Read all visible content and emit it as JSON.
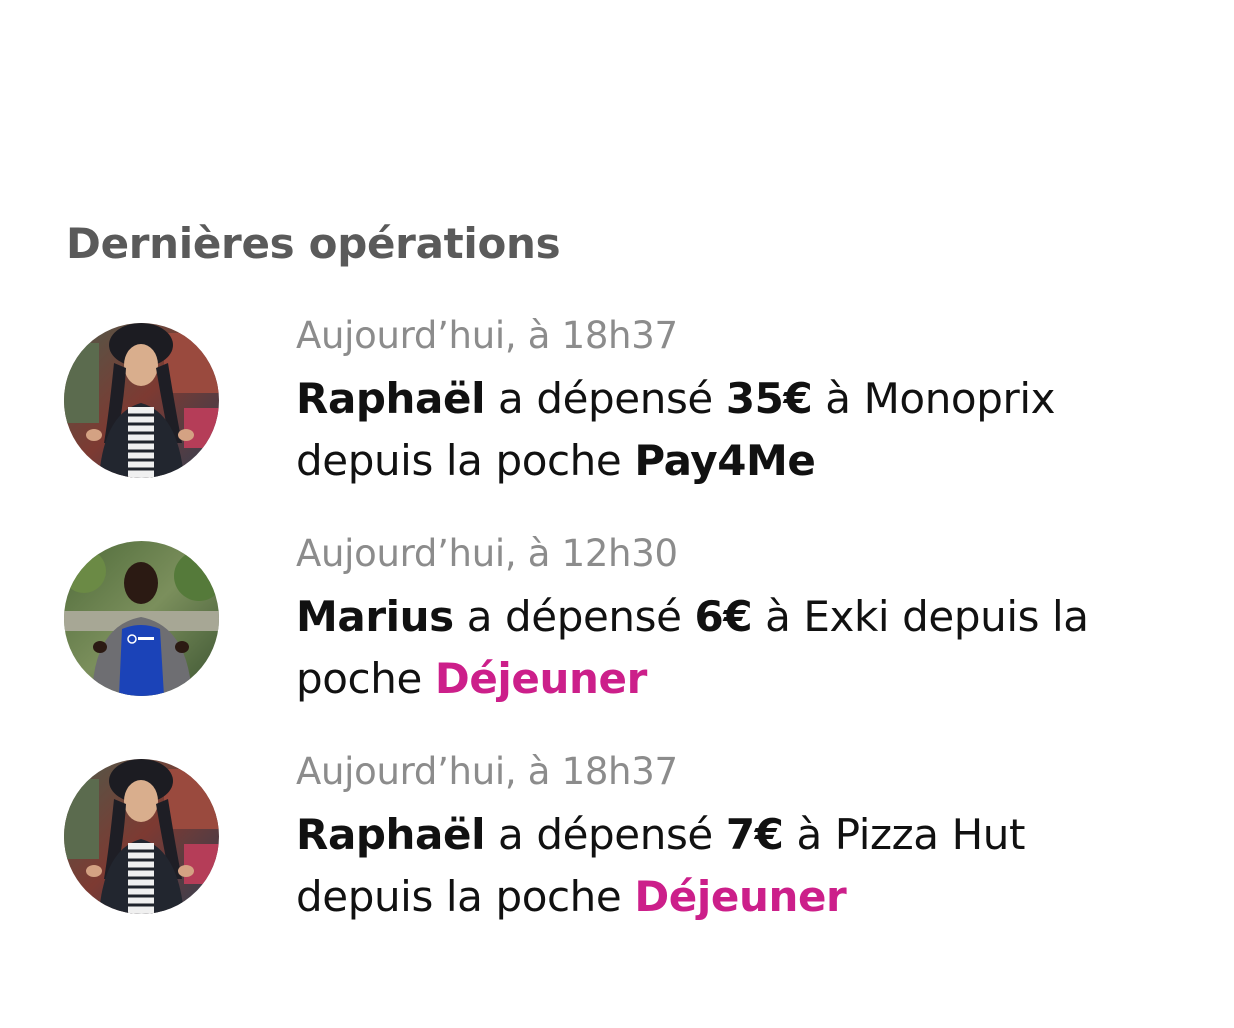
{
  "section": {
    "title": "Dernières opérations"
  },
  "operations": [
    {
      "time": "Aujourd’hui, à 18h37",
      "user": "Raphaël",
      "verb": "a dépensé",
      "amount": "35€",
      "merchant_prefix": "à",
      "merchant": "Monoprix",
      "pocket_prefix": "depuis la poche",
      "pocket": "Pay4Me",
      "avatar": "raphael-avatar"
    },
    {
      "time": "Aujourd’hui, à 12h30",
      "user": "Marius",
      "verb": "a dépensé",
      "amount": "6€",
      "merchant_prefix": "à",
      "merchant": "Exki",
      "pocket_prefix": "depuis la poche",
      "pocket": "Déjeuner",
      "avatar": "marius-avatar"
    },
    {
      "time": "Aujourd’hui, à 18h37",
      "user": "Raphaël",
      "verb": "a dépensé",
      "amount": "7€",
      "merchant_prefix": "à",
      "merchant": "Pizza Hut",
      "pocket_prefix": "depuis la poche",
      "pocket": "Déjeuner",
      "avatar": "raphael-avatar"
    }
  ],
  "colors": {
    "accent": "#cc1f8a",
    "title": "#5a5a5a",
    "time": "#8c8c8c",
    "text": "#111111"
  }
}
